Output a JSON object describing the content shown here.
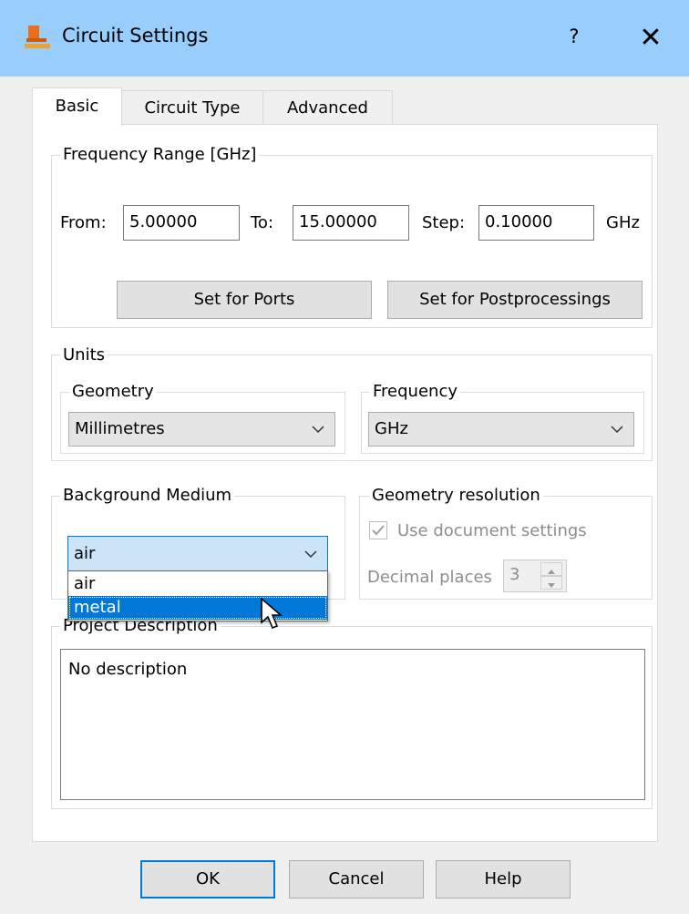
{
  "window": {
    "title": "Circuit Settings",
    "help_symbol": "?",
    "close_symbol": "✕"
  },
  "tabs": [
    "Basic",
    "Circuit Type",
    "Advanced"
  ],
  "frequency_range": {
    "legend": "Frequency Range [GHz]",
    "from_label": "From:",
    "from_value": "5.00000",
    "to_label": "To:",
    "to_value": "15.00000",
    "step_label": "Step:",
    "step_value": "0.10000",
    "unit": "GHz",
    "set_ports_label": "Set for Ports",
    "set_post_label": "Set for Postprocessings"
  },
  "units": {
    "legend": "Units",
    "geometry_legend": "Geometry",
    "geometry_value": "Millimetres",
    "frequency_legend": "Frequency",
    "frequency_value": "GHz"
  },
  "background_medium": {
    "legend": "Background Medium",
    "value": "air",
    "options": [
      "air",
      "metal"
    ],
    "highlighted": "metal"
  },
  "geometry_resolution": {
    "legend": "Geometry resolution",
    "use_doc_label": "Use document settings",
    "use_doc_checked": true,
    "decimal_label": "Decimal places",
    "decimal_value": "3"
  },
  "project_description": {
    "legend": "Project Description",
    "text": "No description"
  },
  "footer": {
    "ok": "OK",
    "cancel": "Cancel",
    "help": "Help"
  },
  "colors": {
    "title_bar": "#99cdfb",
    "selection": "#0078d7",
    "combo_open": "#cce4f7"
  }
}
